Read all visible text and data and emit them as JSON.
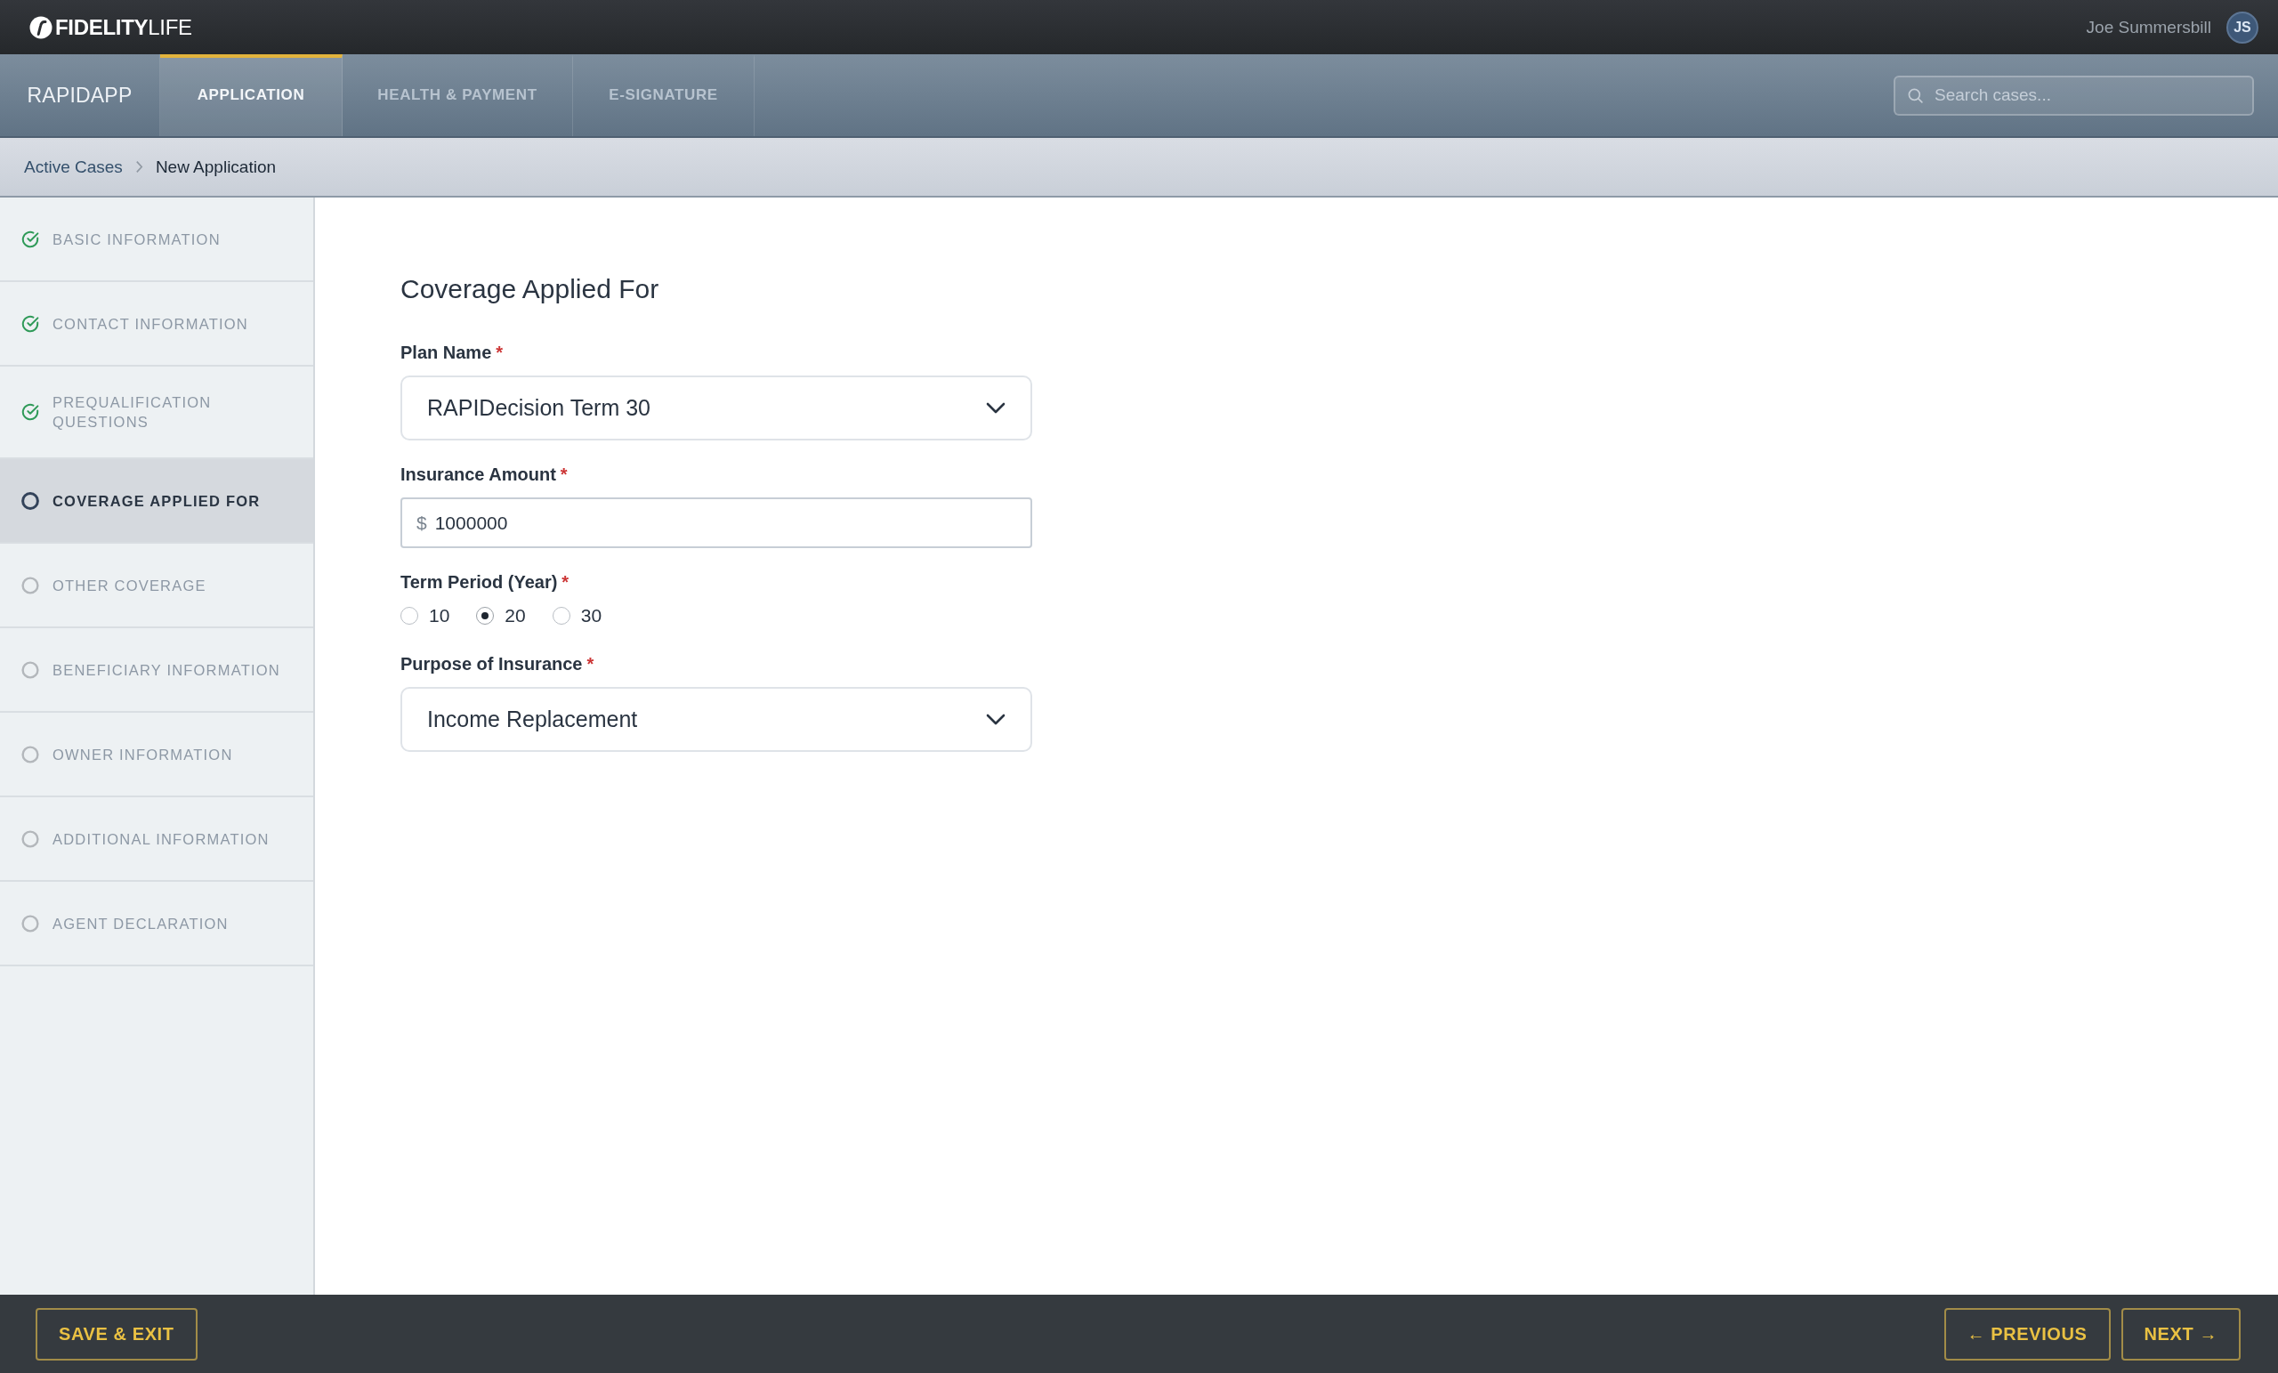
{
  "header": {
    "logo": "**FIDELITY**LIFE",
    "user_name": "Joe Summersbill",
    "avatar_initials": "JS"
  },
  "nav": {
    "app_name": "RAPIDAPP",
    "tabs": [
      {
        "label": "APPLICATION",
        "selected": true
      },
      {
        "label": "HEALTH & PAYMENT",
        "selected": false
      },
      {
        "label": "E-SIGNATURE",
        "selected": false
      }
    ],
    "search": {
      "placeholder": "Search cases..."
    }
  },
  "breadcrumb": [
    "Active Cases",
    "New Application"
  ],
  "sidebar": {
    "items": [
      {
        "label": "BASIC INFORMATION",
        "completed": true,
        "selected": false
      },
      {
        "label": "CONTACT INFORMATION",
        "completed": true,
        "selected": false
      },
      {
        "label": "PREQUALIFICATION QUESTIONS",
        "completed": true,
        "selected": false
      },
      {
        "label": "COVERAGE APPLIED FOR",
        "completed": false,
        "selected": true
      },
      {
        "label": "OTHER COVERAGE",
        "completed": false,
        "selected": false
      },
      {
        "label": "BENEFICIARY INFORMATION",
        "completed": false,
        "selected": false
      },
      {
        "label": "OWNER INFORMATION",
        "completed": false,
        "selected": false
      },
      {
        "label": "ADDITIONAL INFORMATION",
        "completed": false,
        "selected": false
      },
      {
        "label": "AGENT DECLARATION",
        "completed": false,
        "selected": false
      }
    ]
  },
  "form": {
    "title": "Coverage Applied For",
    "fields": [
      {
        "kind": "select",
        "label": "Plan Name",
        "required_mark": "*",
        "value": "RAPIDecision Term 30"
      },
      {
        "kind": "currency",
        "label": "Insurance Amount",
        "required_mark": "*",
        "prefix": "$",
        "value": "1000000"
      },
      {
        "kind": "radio",
        "label": "Term Period (Year)",
        "required_mark": "*",
        "options": [
          {
            "label": "10",
            "selected": false
          },
          {
            "label": "20",
            "selected": true
          },
          {
            "label": "30",
            "selected": false
          }
        ]
      },
      {
        "kind": "select",
        "label": "Purpose of Insurance",
        "required_mark": "*",
        "value": "Income Replacement"
      }
    ]
  },
  "footer": {
    "left_buttons": [
      "SAVE & EXIT"
    ],
    "right_buttons": [
      "← PREVIOUS",
      "NEXT →"
    ]
  }
}
